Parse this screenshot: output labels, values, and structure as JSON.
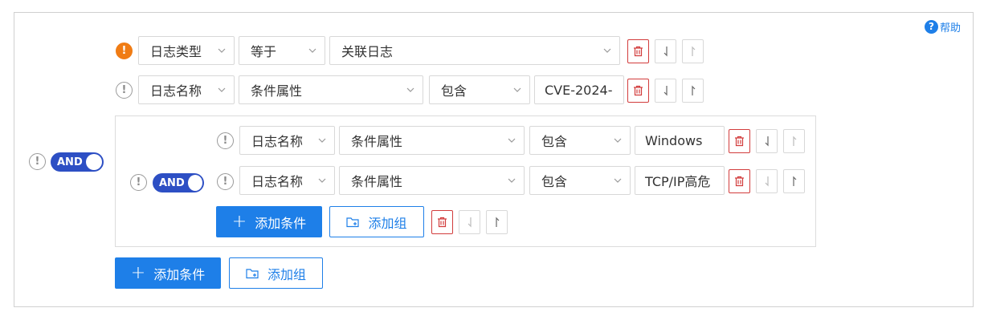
{
  "help": {
    "label": "帮助",
    "icon": "question-circle-icon"
  },
  "root": {
    "operator": "AND",
    "rows": [
      {
        "field": "日志类型",
        "op": "等于",
        "value": "关联日志"
      },
      {
        "field": "日志名称",
        "attr": "条件属性",
        "op": "包含",
        "value": "CVE-2024-"
      }
    ],
    "add_condition_label": "添加条件",
    "add_group_label": "添加组"
  },
  "group": {
    "operator": "AND",
    "rows": [
      {
        "field": "日志名称",
        "attr": "条件属性",
        "op": "包含",
        "value": "Windows"
      },
      {
        "field": "日志名称",
        "attr": "条件属性",
        "op": "包含",
        "value": "TCP/IP高危"
      }
    ],
    "add_condition_label": "添加条件",
    "add_group_label": "添加组"
  },
  "colors": {
    "primary": "#1e7fe8",
    "toggle": "#2d4fc4",
    "delete": "#d23c3c",
    "warning": "#f07c14"
  }
}
